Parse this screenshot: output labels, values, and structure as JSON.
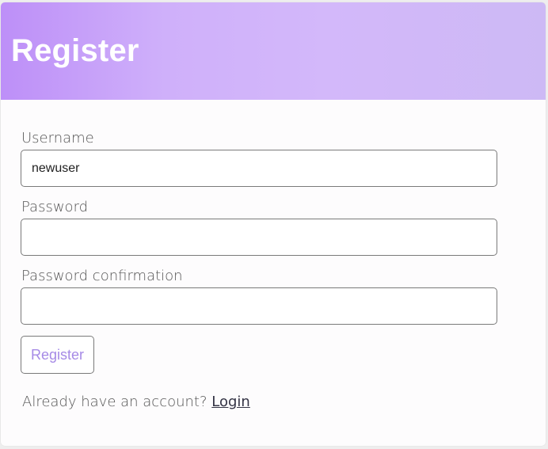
{
  "header": {
    "title": "Register",
    "gradient_colors": [
      "#bd8ff8",
      "#cfb0fa",
      "#d3b8fa",
      "#cdb9f5"
    ]
  },
  "form": {
    "username": {
      "label": "Username",
      "value": "newuser",
      "placeholder": ""
    },
    "password": {
      "label": "Password",
      "value": "",
      "placeholder": ""
    },
    "password_confirmation": {
      "label": "Password confirmation",
      "value": "",
      "placeholder": ""
    },
    "submit_label": "Register",
    "submit_text_color": "#a68ae6"
  },
  "footer": {
    "prompt": "Already have an account?",
    "link_label": "Login"
  }
}
